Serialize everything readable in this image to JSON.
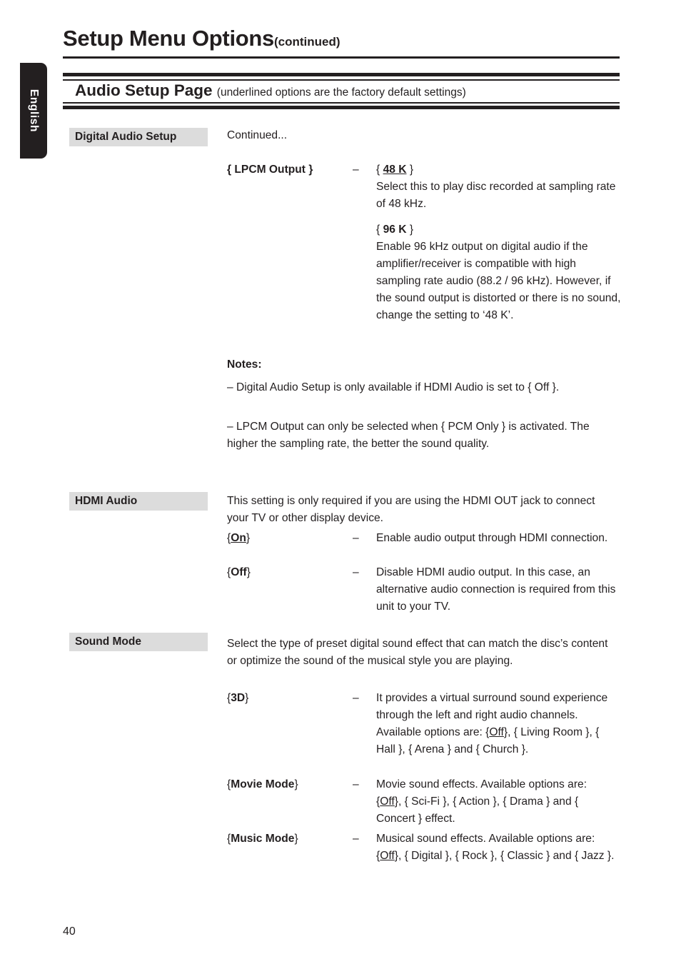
{
  "document": {
    "title": "Setup Menu Options",
    "title_suffix": "(continued)",
    "page_number": "40",
    "language_tab": "English"
  },
  "section": {
    "heading": "Audio Setup Page",
    "heading_note": "(underlined options are the factory default settings)"
  },
  "blocks": {
    "digital_audio_setup": {
      "label": "Digital Audio Setup",
      "intro": "Continued...",
      "rows": [
        {
          "option": "{ LPCM Output }",
          "dash": "–",
          "value_label": "{",
          "value": "48 K",
          "value_close": "}",
          "description": "Select this to play disc recorded at sampling rate of 48 kHz."
        }
      ],
      "second_value_open": "{",
      "second_value": "96 K",
      "second_value_close": "}",
      "second_description": "Enable 96 kHz output on digital audio if the amplifier/receiver is compatible with high sampling rate audio (88.2 / 96 kHz). However, if the sound output is distorted or there is no sound, change the setting to ‘48 K’.",
      "notes_title": "Notes:",
      "note_1": "–  Digital Audio Setup is only available if HDMI Audio is set to { Off }.",
      "note_2": "–  LPCM Output can only be selected when { PCM Only } is activated. The higher the sampling rate, the better the sound quality."
    },
    "hdmi_audio": {
      "label": "HDMI Audio",
      "intro": "This setting is only required if you are using the HDMI OUT jack to connect your TV or other display device.",
      "rows": [
        {
          "open": "{",
          "option": "On",
          "close": "}",
          "dash": "–",
          "description": "Enable audio output through HDMI connection."
        },
        {
          "open": "{",
          "option": "Off",
          "close": "}",
          "dash": "–",
          "description": "Disable HDMI audio output. In this case, an alternative audio connection is required from this unit to your TV."
        }
      ]
    },
    "sound_mode": {
      "label": "Sound Mode",
      "intro": "Select the type of preset digital sound effect that can match the disc’s content or optimize the sound of the musical style you are playing.",
      "rows": [
        {
          "open": "{",
          "option": "3D",
          "close": "}",
          "dash": "–",
          "description_part1": "It provides a virtual surround sound experience through the left and right audio channels. Available options are: {",
          "default_option": "Off",
          "description_part2": "}, { Living Room }, { Hall }, { Arena } and { Church }."
        },
        {
          "open": "{",
          "option": "Movie Mode",
          "close": "}",
          "dash": "–",
          "description_part1": "Movie sound effects. Available options are: {",
          "default_option": "Off",
          "description_part2": "}, { Sci-Fi }, { Action }, { Drama } and { Concert } effect."
        },
        {
          "open": "{",
          "option": "Music Mode",
          "close": "}",
          "dash": "–",
          "description_part1": "Musical sound effects. Available options are: {",
          "default_option": "Off",
          "description_part2": "}, { Digital }, { Rock }, { Classic } and { Jazz }."
        }
      ]
    }
  },
  "colors": {
    "ink": "#231f20",
    "chip_background": "#dcdcdc",
    "tab_background": "#231f20",
    "paper": "#ffffff"
  }
}
